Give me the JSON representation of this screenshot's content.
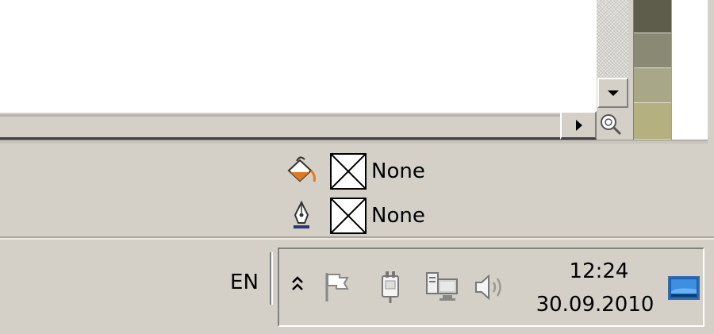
{
  "app": {
    "palette": {
      "swatches": [
        "#5e5c4a",
        "#8a8a74",
        "#a8a888",
        "#b4b080"
      ]
    },
    "fill": {
      "icon": "paint-bucket-icon",
      "value_label": "None"
    },
    "stroke": {
      "icon": "pen-nib-icon",
      "value_label": "None"
    }
  },
  "taskbar": {
    "language": "EN",
    "tray_icons": [
      "show-hidden-icons-icon",
      "action-center-flag-icon",
      "power-plug-icon",
      "network-icon",
      "volume-icon"
    ],
    "clock": {
      "time": "12:24",
      "date": "30.09.2010"
    },
    "show_desktop_icon": "show-desktop-icon"
  },
  "colors": {
    "chrome": "#d4d0c8",
    "fill_accent": "#e07a20"
  }
}
